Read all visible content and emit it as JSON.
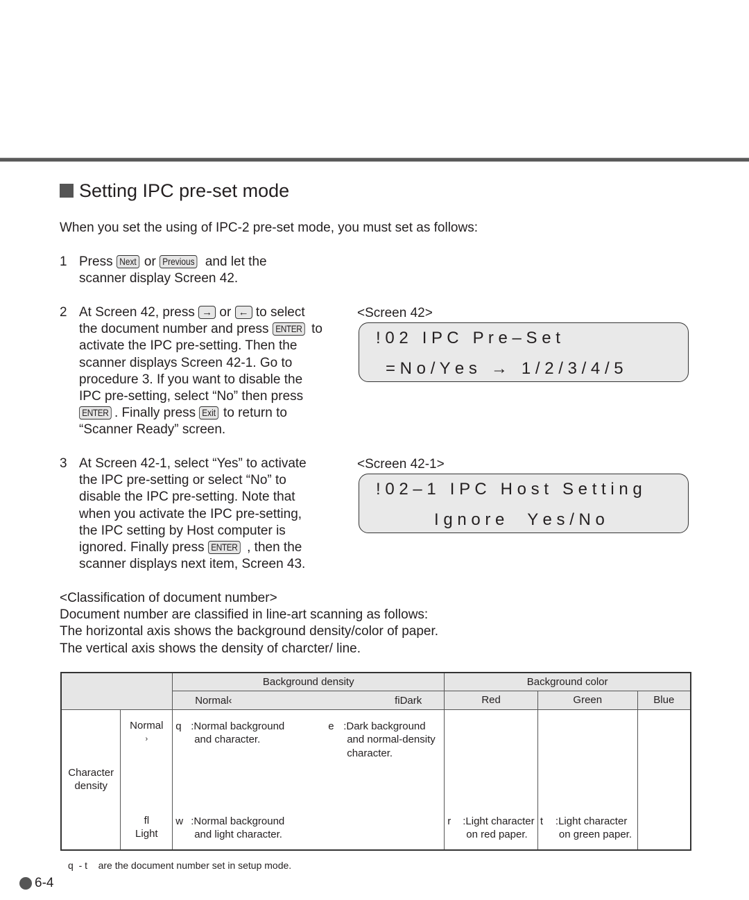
{
  "section": {
    "title": "Setting IPC pre-set mode",
    "intro": "When you set the using of IPC-2 pre-set mode, you must set as follows:"
  },
  "keys": {
    "next": "Next",
    "previous": "Previous",
    "right_arrow": "→",
    "left_arrow": "←",
    "enter": "ENTER",
    "exit": "Exit"
  },
  "steps": [
    {
      "num": "1",
      "lines": {
        "l1a": "Press ",
        "l1b": " or ",
        "l1c": " and let the",
        "l2": "scanner display Screen 42."
      }
    },
    {
      "num": "2",
      "lines": {
        "l1a": "At Screen 42, press ",
        "l1b": " or ",
        "l1c": " to select",
        "l2a": "the document number and press ",
        "l2b": " to",
        "l3": "activate the IPC pre-setting. Then the",
        "l4": "scanner displays Screen 42-1. Go to",
        "l5": "procedure 3. If you want to disable the",
        "l6": "IPC pre-setting, select “No” then press",
        "l7a": ". Finally press ",
        "l7b": " to return to",
        "l8": "“Scanner Ready” screen."
      }
    },
    {
      "num": "3",
      "lines": {
        "l1": "At Screen 42-1, select “Yes” to activate",
        "l2": "the IPC pre-setting or select “No” to",
        "l3": "disable the IPC pre-setting. Note that",
        "l4": "when you activate the IPC pre-setting,",
        "l5": "the IPC setting by Host computer is",
        "l6a": "ignored.  Finally press ",
        "l6b": " , then the",
        "l7": "scanner displays next item, Screen 43."
      }
    }
  ],
  "screens": [
    {
      "label": "<Screen 42>",
      "line1": "! 0 2   I P C   P r e – S e t",
      "line2": "= N o / Y e s   →   1 / 2 / 3 / 4 / 5"
    },
    {
      "label": "<Screen 42-1>",
      "line1": "! 0 2 – 1   I P C   H o s t   S e t t i n g",
      "line2": "I g n o r e     Y e s / N o"
    }
  ],
  "classification": {
    "heading": "<Classification of document number>",
    "line1": "Document number are classified in line-art scanning as follows:",
    "line2": "The horizontal axis shows the background density/color of paper.",
    "line3": "The vertical axis shows the density of charcter/ line."
  },
  "table": {
    "bg_density": "Background density",
    "bg_color": "Background color",
    "density_normal": "Normal‹",
    "density_dark": "ﬁDark",
    "color_red": "Red",
    "color_green": "Green",
    "color_blue": "Blue",
    "row_header": "Character\ndensity",
    "char_normal": "Normal",
    "char_normal_arrow": "›",
    "char_light_arrow": "ﬂ",
    "char_light": "Light",
    "entries": {
      "q": {
        "code": "q",
        "line1": ":Normal background",
        "line2": "and character."
      },
      "e": {
        "code": "e",
        "line1": ":Dark background",
        "line2": "and normal-density",
        "line3": "character."
      },
      "w": {
        "code": "w",
        "line1": ":Normal background",
        "line2": "and light character."
      },
      "r": {
        "code": "r",
        "line1": ":Light character",
        "line2": "on red paper."
      },
      "t": {
        "code": "t",
        "line1": ":Light character",
        "line2": "on green paper."
      }
    }
  },
  "footnote": "q  - t    are the document number set in setup mode.",
  "page_number": "6-4"
}
